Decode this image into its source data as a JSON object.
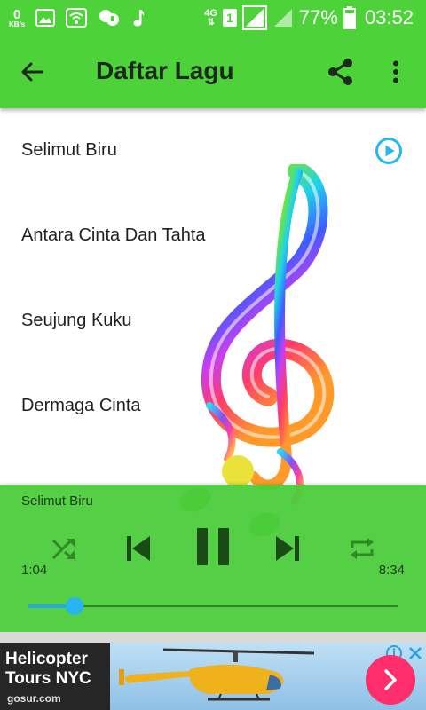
{
  "status_bar": {
    "net_speed_value": "0",
    "net_speed_unit": "KB/s",
    "network_type": "4G",
    "sim_slot": "1",
    "battery_percent": "77%",
    "time": "03:52"
  },
  "toolbar": {
    "title": "Daftar Lagu",
    "back_icon": "arrow-back-icon",
    "share_icon": "share-icon",
    "more_icon": "more-vert-icon"
  },
  "songs": [
    {
      "title": "Selimut Biru",
      "playing": true
    },
    {
      "title": "Antara Cinta Dan Tahta",
      "playing": false
    },
    {
      "title": "Seujung Kuku",
      "playing": false
    },
    {
      "title": "Dermaga Cinta",
      "playing": false
    }
  ],
  "player": {
    "now_playing": "Selimut Biru",
    "elapsed": "1:04",
    "duration": "8:34",
    "progress": 0.1245,
    "controls": [
      "shuffle-icon",
      "skip-previous-icon",
      "pause-icon",
      "skip-next-icon",
      "repeat-icon"
    ]
  },
  "ad": {
    "headline": "Helicopter Tours NYC",
    "domain": "gosur.com",
    "info_icon": "info-icon",
    "close_icon": "close-icon",
    "cta_icon": "chevron-right-icon"
  },
  "colors": {
    "primary": "#4ed23a",
    "accent": "#29b6f0",
    "ad_cta": "#ff2f6d"
  }
}
